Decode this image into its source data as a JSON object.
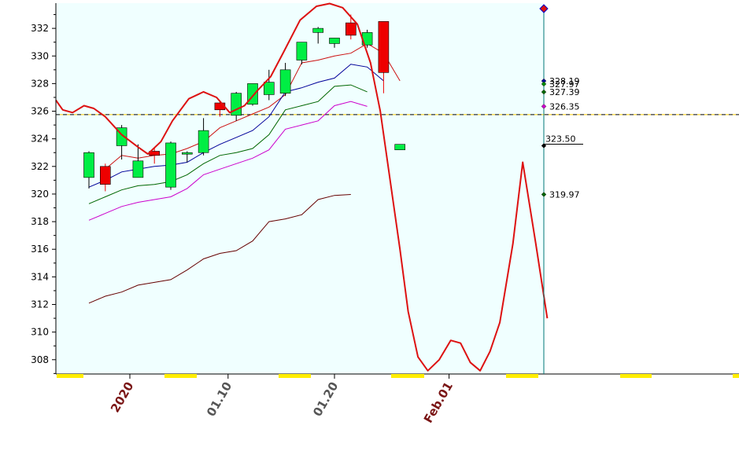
{
  "chart_data": {
    "type": "candlestick",
    "ylim": [
      307,
      333.6
    ],
    "yticks": [
      "332",
      "330",
      "328",
      "326",
      "324",
      "322",
      "320",
      "318",
      "316",
      "314",
      "312",
      "310",
      "308"
    ],
    "x_labels": [
      {
        "text": "2020",
        "bar": 2.5,
        "color": "#7a1515"
      },
      {
        "text": "01.10",
        "bar": 8.5,
        "color": "#555555"
      },
      {
        "text": "01.20",
        "bar": 15,
        "color": "#555555"
      },
      {
        "text": "Feb.01",
        "bar": 22,
        "color": "#7a1515"
      }
    ],
    "candles": [
      {
        "o": 321.2,
        "h": 323.1,
        "l": 320.4,
        "c": 323.0
      },
      {
        "o": 322.0,
        "h": 322.2,
        "l": 320.2,
        "c": 320.7
      },
      {
        "o": 323.5,
        "h": 325.0,
        "l": 322.5,
        "c": 324.8
      },
      {
        "o": 321.2,
        "h": 323.6,
        "l": 321.2,
        "c": 322.4
      },
      {
        "o": 323.1,
        "h": 323.3,
        "l": 322.2,
        "c": 322.8
      },
      {
        "o": 320.5,
        "h": 323.8,
        "l": 320.3,
        "c": 323.7
      },
      {
        "o": 322.9,
        "h": 323.1,
        "l": 322.3,
        "c": 323.0
      },
      {
        "o": 323.0,
        "h": 325.5,
        "l": 322.8,
        "c": 324.6
      },
      {
        "o": 326.6,
        "h": 326.7,
        "l": 325.6,
        "c": 326.1
      },
      {
        "o": 325.7,
        "h": 327.4,
        "l": 325.3,
        "c": 327.3
      },
      {
        "o": 326.5,
        "h": 328.0,
        "l": 326.4,
        "c": 328.0
      },
      {
        "o": 327.2,
        "h": 329.0,
        "l": 326.8,
        "c": 328.1
      },
      {
        "o": 327.3,
        "h": 329.5,
        "l": 327.1,
        "c": 329.0
      },
      {
        "o": 329.7,
        "h": 331.0,
        "l": 329.4,
        "c": 331.0
      },
      {
        "o": 331.7,
        "h": 332.1,
        "l": 330.9,
        "c": 332.0
      },
      {
        "o": 330.9,
        "h": 331.3,
        "l": 330.6,
        "c": 331.3
      },
      {
        "o": 332.4,
        "h": 333.0,
        "l": 331.2,
        "c": 331.5
      },
      {
        "o": 330.8,
        "h": 331.9,
        "l": 330.6,
        "c": 331.7
      },
      {
        "o": 332.5,
        "h": 332.5,
        "l": 327.3,
        "c": 328.8
      },
      {
        "o": 323.2,
        "h": 323.6,
        "l": 323.2,
        "c": 323.6
      }
    ],
    "series": [
      {
        "color": "#cc1111",
        "width": 1,
        "values": [
          null,
          321.8,
          322.8,
          322.6,
          322.8,
          322.9,
          323.3,
          323.8,
          324.8,
          325.3,
          325.8,
          326.3,
          327.2,
          329.5,
          329.7,
          330.0,
          330.2,
          330.9,
          330.2,
          328.2
        ]
      },
      {
        "color": "#000099",
        "width": 1,
        "values": [
          320.5,
          321.0,
          321.6,
          321.8,
          322.0,
          322.1,
          322.3,
          323.0,
          323.6,
          324.1,
          324.6,
          325.6,
          327.4,
          327.7,
          328.1,
          328.4,
          329.4,
          329.2,
          328.2,
          null
        ]
      },
      {
        "color": "#006600",
        "width": 1,
        "values": [
          319.3,
          319.8,
          320.3,
          320.6,
          320.7,
          320.9,
          321.4,
          322.2,
          322.8,
          323.0,
          323.3,
          324.3,
          326.1,
          326.4,
          326.7,
          327.8,
          327.9,
          327.4,
          null,
          null
        ]
      },
      {
        "color": "#cc00cc",
        "width": 1,
        "values": [
          318.1,
          318.6,
          319.1,
          319.4,
          319.6,
          319.8,
          320.4,
          321.4,
          321.8,
          322.2,
          322.6,
          323.2,
          324.7,
          325.0,
          325.3,
          326.4,
          326.7,
          326.35,
          null,
          null
        ]
      },
      {
        "color": "#660000",
        "width": 1,
        "values": [
          312.1,
          312.6,
          312.9,
          313.4,
          313.6,
          313.8,
          314.5,
          315.3,
          315.7,
          315.9,
          316.6,
          318.0,
          318.2,
          318.5,
          319.6,
          319.9,
          319.97,
          null,
          null,
          null
        ]
      }
    ],
    "oscillator": {
      "color": "#dd1111",
      "points": [
        [
          -2.4,
          326.8
        ],
        [
          -1.6,
          326.1
        ],
        [
          -1,
          325.9
        ],
        [
          -0.3,
          326.4
        ],
        [
          0.3,
          326.2
        ],
        [
          1,
          325.6
        ],
        [
          2,
          324.3
        ],
        [
          3,
          323.4
        ],
        [
          3.6,
          322.9
        ],
        [
          4.4,
          323.8
        ],
        [
          5.1,
          325.3
        ],
        [
          6.1,
          326.9
        ],
        [
          7,
          327.4
        ],
        [
          7.8,
          327.0
        ],
        [
          8.6,
          325.9
        ],
        [
          9.5,
          326.4
        ],
        [
          10.3,
          327.5
        ],
        [
          11.1,
          328.5
        ],
        [
          11.9,
          330.3
        ],
        [
          12.9,
          332.6
        ],
        [
          13.9,
          333.6
        ],
        [
          14.7,
          333.8
        ],
        [
          15.5,
          333.5
        ],
        [
          16.4,
          332.3
        ],
        [
          17.2,
          329.5
        ],
        [
          17.8,
          326.0
        ],
        [
          18.4,
          321.0
        ],
        [
          19.0,
          316.0
        ],
        [
          19.5,
          311.5
        ],
        [
          20.1,
          308.2
        ],
        [
          20.7,
          307.2
        ],
        [
          21.4,
          308.0
        ],
        [
          22.1,
          309.4
        ],
        [
          22.7,
          309.2
        ],
        [
          23.3,
          307.8
        ],
        [
          23.9,
          307.2
        ],
        [
          24.5,
          308.6
        ],
        [
          25.1,
          310.7
        ],
        [
          25.9,
          316.4
        ],
        [
          26.5,
          322.3
        ],
        [
          27.3,
          316.4
        ],
        [
          28.0,
          311.0
        ]
      ]
    },
    "end_labels": [
      {
        "text": "328.19",
        "value": 328.19,
        "color": "#000099"
      },
      {
        "text": "327.97",
        "value": 327.97,
        "color": "#008800"
      },
      {
        "text": "327.39",
        "value": 327.39,
        "color": "#006600"
      },
      {
        "text": "326.35",
        "value": 326.35,
        "color": "#cc00cc"
      },
      {
        "text": "323.50",
        "value": 323.5,
        "color": "#000000"
      },
      {
        "text": "319.97",
        "value": 319.97,
        "color": "#006600"
      }
    ],
    "reference_line": {
      "value": 325.75
    },
    "colors": {
      "plot_background": "#f0ffff",
      "up_candle": "#00ee44",
      "down_candle": "#ee0000",
      "highlight_band": "#ffee00"
    }
  }
}
